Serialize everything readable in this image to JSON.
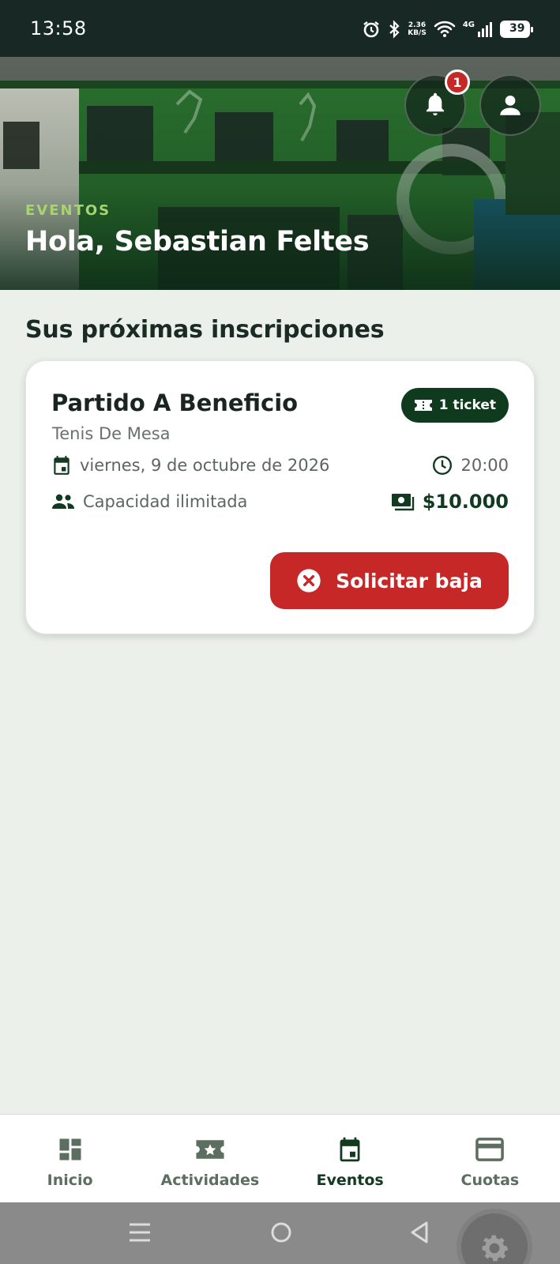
{
  "status_bar": {
    "time": "13:58",
    "speed_value": "2.36",
    "speed_unit": "KB/S",
    "network": "4G",
    "battery": "39",
    "icons": [
      "alarm-icon",
      "bluetooth-icon",
      "wifi-icon",
      "signal-icon",
      "battery-icon"
    ]
  },
  "hero": {
    "kicker": "EVENTOS",
    "greeting": "Hola, Sebastian Feltes",
    "notification_count": "1"
  },
  "section": {
    "title": "Sus próximas inscripciones"
  },
  "event_card": {
    "title": "Partido A Beneficio",
    "category": "Tenis De Mesa",
    "ticket_label": "1 ticket",
    "date": "viernes, 9 de octubre de 2026",
    "time": "20:00",
    "capacity": "Capacidad ilimitada",
    "price": "$10.000",
    "cancel_label": "Solicitar baja"
  },
  "bottom_nav": {
    "items": [
      {
        "label": "Inicio",
        "icon": "dashboard-icon",
        "active": false
      },
      {
        "label": "Actividades",
        "icon": "star-ticket-icon",
        "active": false
      },
      {
        "label": "Eventos",
        "icon": "calendar-icon",
        "active": true
      },
      {
        "label": "Cuotas",
        "icon": "credit-card-icon",
        "active": false
      }
    ]
  },
  "colors": {
    "brand_dark": "#123a20",
    "accent_green": "#a8d46f",
    "danger": "#c62828",
    "background": "#ebf0eb"
  }
}
